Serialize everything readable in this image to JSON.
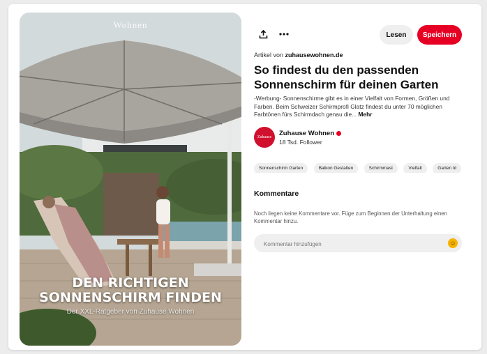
{
  "pin_image": {
    "brand_logo": "Wohnen",
    "headline_line1": "DEN RICHTIGEN",
    "headline_line2": "SONNENSCHIRM FINDEN",
    "subline": "Der XXL-Ratgeber von Zuhause Wohnen"
  },
  "toolbar": {
    "share_icon": "share-icon",
    "more_icon": "more-options-icon",
    "read_label": "Lesen",
    "save_label": "Speichern"
  },
  "source": {
    "prefix": "Artikel von",
    "domain": "zuhausewohnen.de"
  },
  "title": "So findest du den passenden Sonnenschirm für deinen Garten",
  "description": {
    "text": "-Werbung- Sonnenschirme gibt es in einer Vielfalt von Formen, Größen und Farben. Beim Schweizer Schirmprofi Glatz findest du unter 70 möglichen Farbtönen fürs Schirmdach genau die...",
    "more_label": "Mehr"
  },
  "creator": {
    "avatar_text": "Zuhause",
    "name": "Zuhause Wohnen",
    "followers": "18 Tsd. Follower"
  },
  "tags": [
    "Sonnenschirm Garten",
    "Balkon Gestalten",
    "Schirmmast",
    "Vielfalt",
    "Garten Id"
  ],
  "comments": {
    "title": "Kommentare",
    "empty_text": "Noch liegen keine Kommentare vor. Füge zum Beginnen der Unterhaltung einen Kommentar hinzu.",
    "input_placeholder": "Kommentar hinzufügen",
    "emoji_icon": "smiley-emoji-icon"
  },
  "colors": {
    "save_button": "#e60023",
    "avatar_bg": "#d1102e"
  }
}
